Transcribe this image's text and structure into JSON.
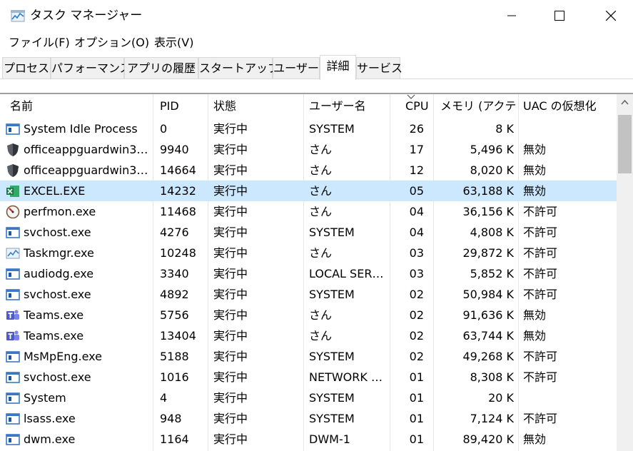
{
  "window": {
    "title": "タスク マネージャー",
    "minimize_icon": "minimize-icon",
    "maximize_icon": "maximize-icon",
    "close_icon": "close-icon"
  },
  "menu": [
    "ファイル(F)",
    "オプション(O)",
    "表示(V)"
  ],
  "tabs": [
    "プロセス",
    "パフォーマンス",
    "アプリの履歴",
    "スタートアップ",
    "ユーザー",
    "詳細",
    "サービス"
  ],
  "active_tab": "詳細",
  "columns": [
    "名前",
    "PID",
    "状態",
    "ユーザー名",
    "CPU",
    "メモリ (アクテ…",
    "UAC の仮想化"
  ],
  "sorted_column": "CPU",
  "selection_color": "#cce8ff",
  "rows": [
    {
      "name": "System Idle Process",
      "pid": "0",
      "status": "実行中",
      "user": "SYSTEM",
      "cpu": "26",
      "memory": "8 K",
      "uac": "",
      "icon": "system-process-icon"
    },
    {
      "name": "officeappguardwin3…",
      "pid": "9940",
      "status": "実行中",
      "user": "さん",
      "cpu": "17",
      "memory": "5,496 K",
      "uac": "無効",
      "icon": "shield-icon"
    },
    {
      "name": "officeappguardwin3…",
      "pid": "14664",
      "status": "実行中",
      "user": "さん",
      "cpu": "12",
      "memory": "8,020 K",
      "uac": "無効",
      "icon": "shield-icon"
    },
    {
      "name": "EXCEL.EXE",
      "pid": "14232",
      "status": "実行中",
      "user": "さん",
      "cpu": "05",
      "memory": "63,188 K",
      "uac": "無効",
      "icon": "excel-icon",
      "selected": true
    },
    {
      "name": "perfmon.exe",
      "pid": "11468",
      "status": "実行中",
      "user": "さん",
      "cpu": "04",
      "memory": "36,156 K",
      "uac": "不許可",
      "icon": "gauge-icon"
    },
    {
      "name": "svchost.exe",
      "pid": "4276",
      "status": "実行中",
      "user": "SYSTEM",
      "cpu": "04",
      "memory": "4,808 K",
      "uac": "不許可",
      "icon": "system-process-icon"
    },
    {
      "name": "Taskmgr.exe",
      "pid": "10248",
      "status": "実行中",
      "user": "さん",
      "cpu": "03",
      "memory": "29,872 K",
      "uac": "不許可",
      "icon": "task-manager-icon"
    },
    {
      "name": "audiodg.exe",
      "pid": "3340",
      "status": "実行中",
      "user": "LOCAL SER…",
      "cpu": "03",
      "memory": "5,852 K",
      "uac": "不許可",
      "icon": "system-process-icon"
    },
    {
      "name": "svchost.exe",
      "pid": "4892",
      "status": "実行中",
      "user": "SYSTEM",
      "cpu": "02",
      "memory": "50,984 K",
      "uac": "不許可",
      "icon": "system-process-icon"
    },
    {
      "name": "Teams.exe",
      "pid": "5756",
      "status": "実行中",
      "user": "さん",
      "cpu": "02",
      "memory": "91,636 K",
      "uac": "無効",
      "icon": "teams-icon"
    },
    {
      "name": "Teams.exe",
      "pid": "13404",
      "status": "実行中",
      "user": "さん",
      "cpu": "02",
      "memory": "63,744 K",
      "uac": "無効",
      "icon": "teams-icon"
    },
    {
      "name": "MsMpEng.exe",
      "pid": "5188",
      "status": "実行中",
      "user": "SYSTEM",
      "cpu": "02",
      "memory": "49,268 K",
      "uac": "不許可",
      "icon": "system-process-icon"
    },
    {
      "name": "svchost.exe",
      "pid": "1016",
      "status": "実行中",
      "user": "NETWORK …",
      "cpu": "01",
      "memory": "8,308 K",
      "uac": "不許可",
      "icon": "system-process-icon"
    },
    {
      "name": "System",
      "pid": "4",
      "status": "実行中",
      "user": "SYSTEM",
      "cpu": "01",
      "memory": "20 K",
      "uac": "",
      "icon": "system-process-icon"
    },
    {
      "name": "lsass.exe",
      "pid": "948",
      "status": "実行中",
      "user": "SYSTEM",
      "cpu": "01",
      "memory": "7,124 K",
      "uac": "不許可",
      "icon": "system-process-icon"
    },
    {
      "name": "dwm.exe",
      "pid": "1164",
      "status": "実行中",
      "user": "DWM-1",
      "cpu": "01",
      "memory": "89,420 K",
      "uac": "無効",
      "icon": "system-process-icon"
    }
  ]
}
